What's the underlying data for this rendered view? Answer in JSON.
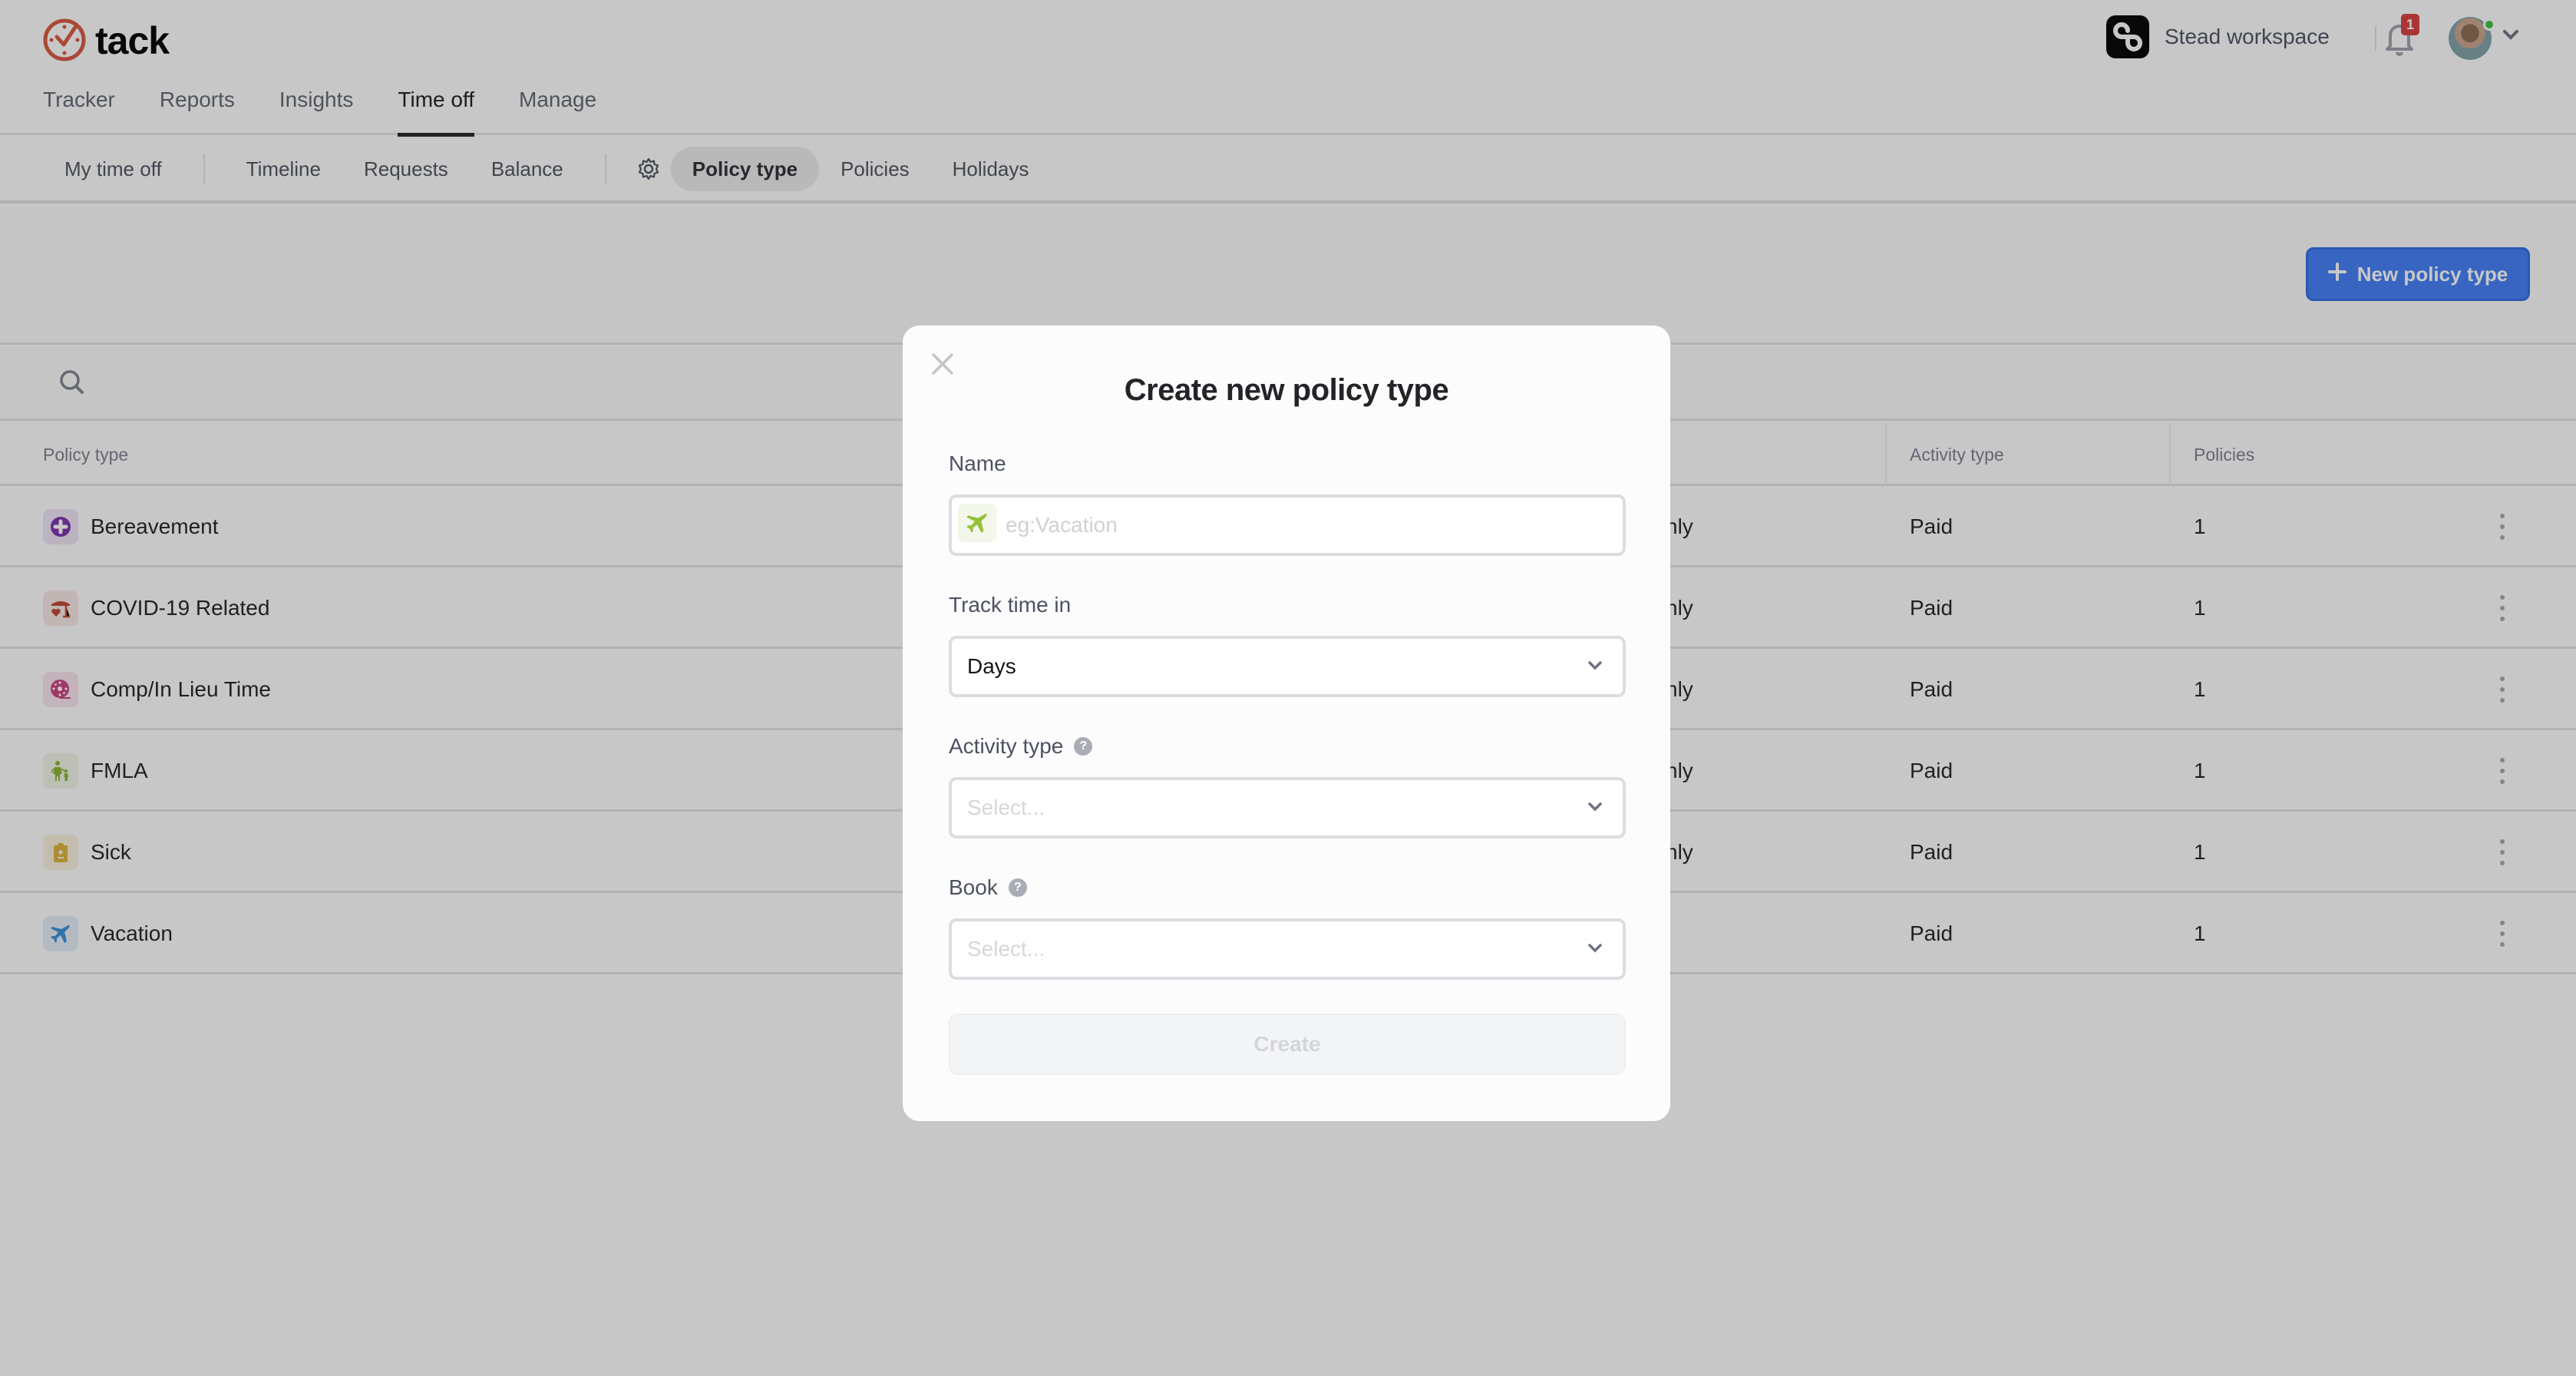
{
  "app": {
    "name": "tack",
    "brand_color": "#d9553f"
  },
  "header": {
    "main_nav": [
      {
        "label": "Tracker",
        "active": false
      },
      {
        "label": "Reports",
        "active": false
      },
      {
        "label": "Insights",
        "active": false
      },
      {
        "label": "Time off",
        "active": true
      },
      {
        "label": "Manage",
        "active": false
      }
    ],
    "workspace_name": "Stead workspace",
    "notifications_count": "1",
    "user_status": "online"
  },
  "subnav": {
    "my_time_off": "My time off",
    "timeline": "Timeline",
    "requests": "Requests",
    "balance": "Balance",
    "settings_icon": "gear-icon",
    "policy_type": "Policy type",
    "policies": "Policies",
    "holidays": "Holidays",
    "active": "Policy type"
  },
  "toolbar": {
    "new_button_label": "New policy type",
    "accent_color": "#3f7cf7"
  },
  "search": {
    "icon": "search-icon"
  },
  "table": {
    "columns": {
      "policy_type": "Policy type",
      "activity_type": "Activity type",
      "policies": "Policies"
    },
    "rows": [
      {
        "name": "Bereavement",
        "icon": "medical-cross-icon",
        "icon_color": "#7b2fae",
        "icon_bg": "#efe6f6",
        "partial_col": "nly",
        "activity_type": "Paid",
        "policies": "1"
      },
      {
        "name": "COVID-19 Related",
        "icon": "storefront-heart-icon",
        "icon_color": "#c0442f",
        "icon_bg": "#f8e9e6",
        "partial_col": "nly",
        "activity_type": "Paid",
        "policies": "1"
      },
      {
        "name": "Comp/In Lieu Time",
        "icon": "film-reel-icon",
        "icon_color": "#c9407c",
        "icon_bg": "#f8e6ee",
        "partial_col": "nly",
        "activity_type": "Paid",
        "policies": "1"
      },
      {
        "name": "FMLA",
        "icon": "parent-child-icon",
        "icon_color": "#86b330",
        "icon_bg": "#f1f5e6",
        "partial_col": "nly",
        "activity_type": "Paid",
        "policies": "1"
      },
      {
        "name": "Sick",
        "icon": "medical-clipboard-icon",
        "icon_color": "#dfb23a",
        "icon_bg": "#faf2dd",
        "partial_col": "nly",
        "activity_type": "Paid",
        "policies": "1"
      },
      {
        "name": "Vacation",
        "icon": "airplane-icon",
        "icon_color": "#3b8fd6",
        "icon_bg": "#e4eef8",
        "partial_col": "",
        "activity_type": "Paid",
        "policies": "1"
      }
    ]
  },
  "modal": {
    "title": "Create new policy type",
    "name_label": "Name",
    "name_placeholder": "eg:Vacation",
    "name_value": "",
    "name_icon": "airplane-icon",
    "track_label": "Track time in",
    "track_value": "Days",
    "activity_label": "Activity type",
    "activity_placeholder": "Select...",
    "book_label": "Book",
    "book_placeholder": "Select...",
    "help_glyph": "?",
    "create_label": "Create",
    "create_enabled": false
  }
}
